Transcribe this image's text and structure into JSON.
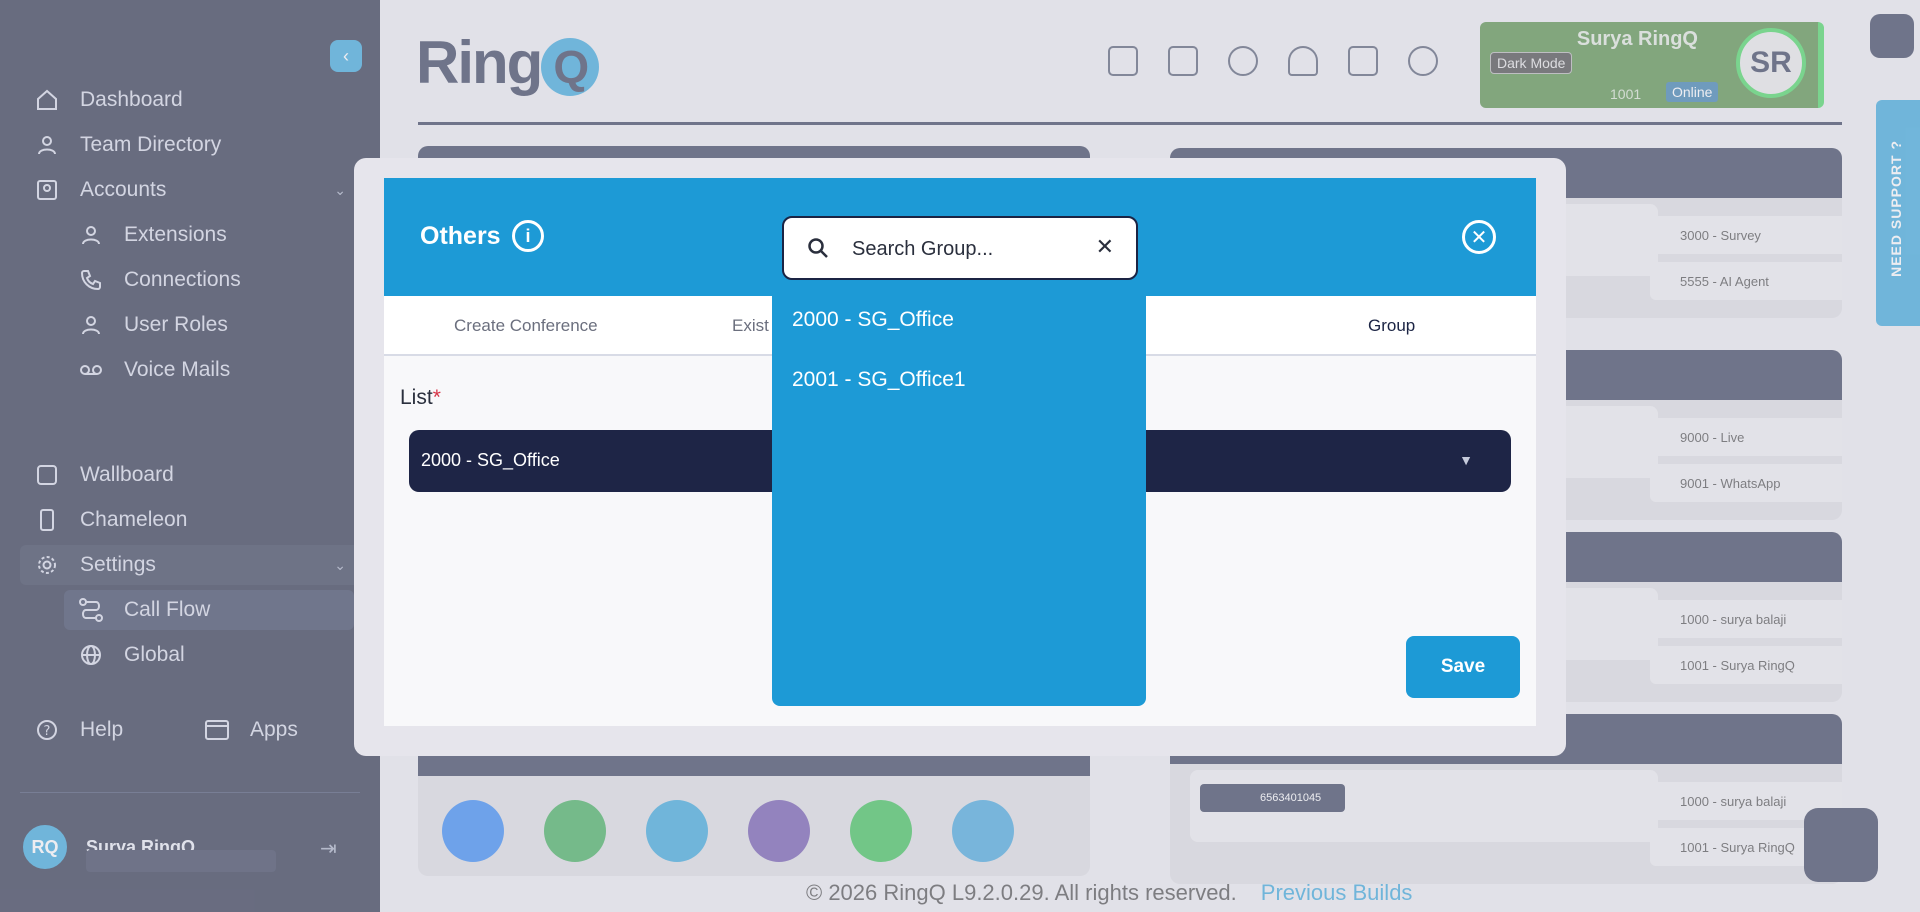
{
  "sidebar": {
    "items": [
      {
        "label": "Dashboard"
      },
      {
        "label": "Team Directory"
      },
      {
        "label": "Accounts"
      },
      {
        "label": "Extensions"
      },
      {
        "label": "Connections"
      },
      {
        "label": "User Roles"
      },
      {
        "label": "Voice Mails"
      },
      {
        "label": "Wallboard"
      },
      {
        "label": "Chameleon"
      },
      {
        "label": "Settings"
      },
      {
        "label": "Call Flow"
      },
      {
        "label": "Global"
      },
      {
        "label": "Help"
      },
      {
        "label": "Apps"
      }
    ],
    "user_name": "Surya RingQ",
    "user_initials": "RQ"
  },
  "header": {
    "logo_text": "Ring",
    "logo_q": "Q",
    "profile_name": "Surya RingQ",
    "dark_mode_label": "Dark Mode",
    "extension": "1001",
    "status": "Online",
    "avatar_initials": "SR",
    "support_label": "NEED SUPPORT ?"
  },
  "right_panels": [
    {
      "items": [
        "3000 - Survey",
        "5555 - AI Agent"
      ]
    },
    {
      "items": [
        "9000 - Live",
        "9001 - WhatsApp"
      ]
    },
    {
      "items": [
        "1000 - surya balaji",
        "1001 - Surya RingQ"
      ]
    },
    {
      "items": [
        "1000 - surya balaji",
        "1001 - Surya RingQ"
      ],
      "number": "6563401045"
    }
  ],
  "footer": {
    "copyright": "© 2026 RingQ L9.2.0.29. All rights reserved.",
    "link": "Previous Builds"
  },
  "modal": {
    "title": "Others",
    "tabs": [
      "Create Conference",
      "Exist",
      "Group"
    ],
    "list_label": "List",
    "required_mark": "*",
    "selected_value": "2000 - SG_Office",
    "save_label": "Save"
  },
  "search": {
    "placeholder": "Search Group...",
    "options": [
      "2000 - SG_Office",
      "2001 - SG_Office1"
    ]
  },
  "colors": {
    "sidebar": "#0e1530",
    "accent": "#1d9ad6",
    "navy": "#1b2444",
    "online_green": "#2fd14c"
  }
}
